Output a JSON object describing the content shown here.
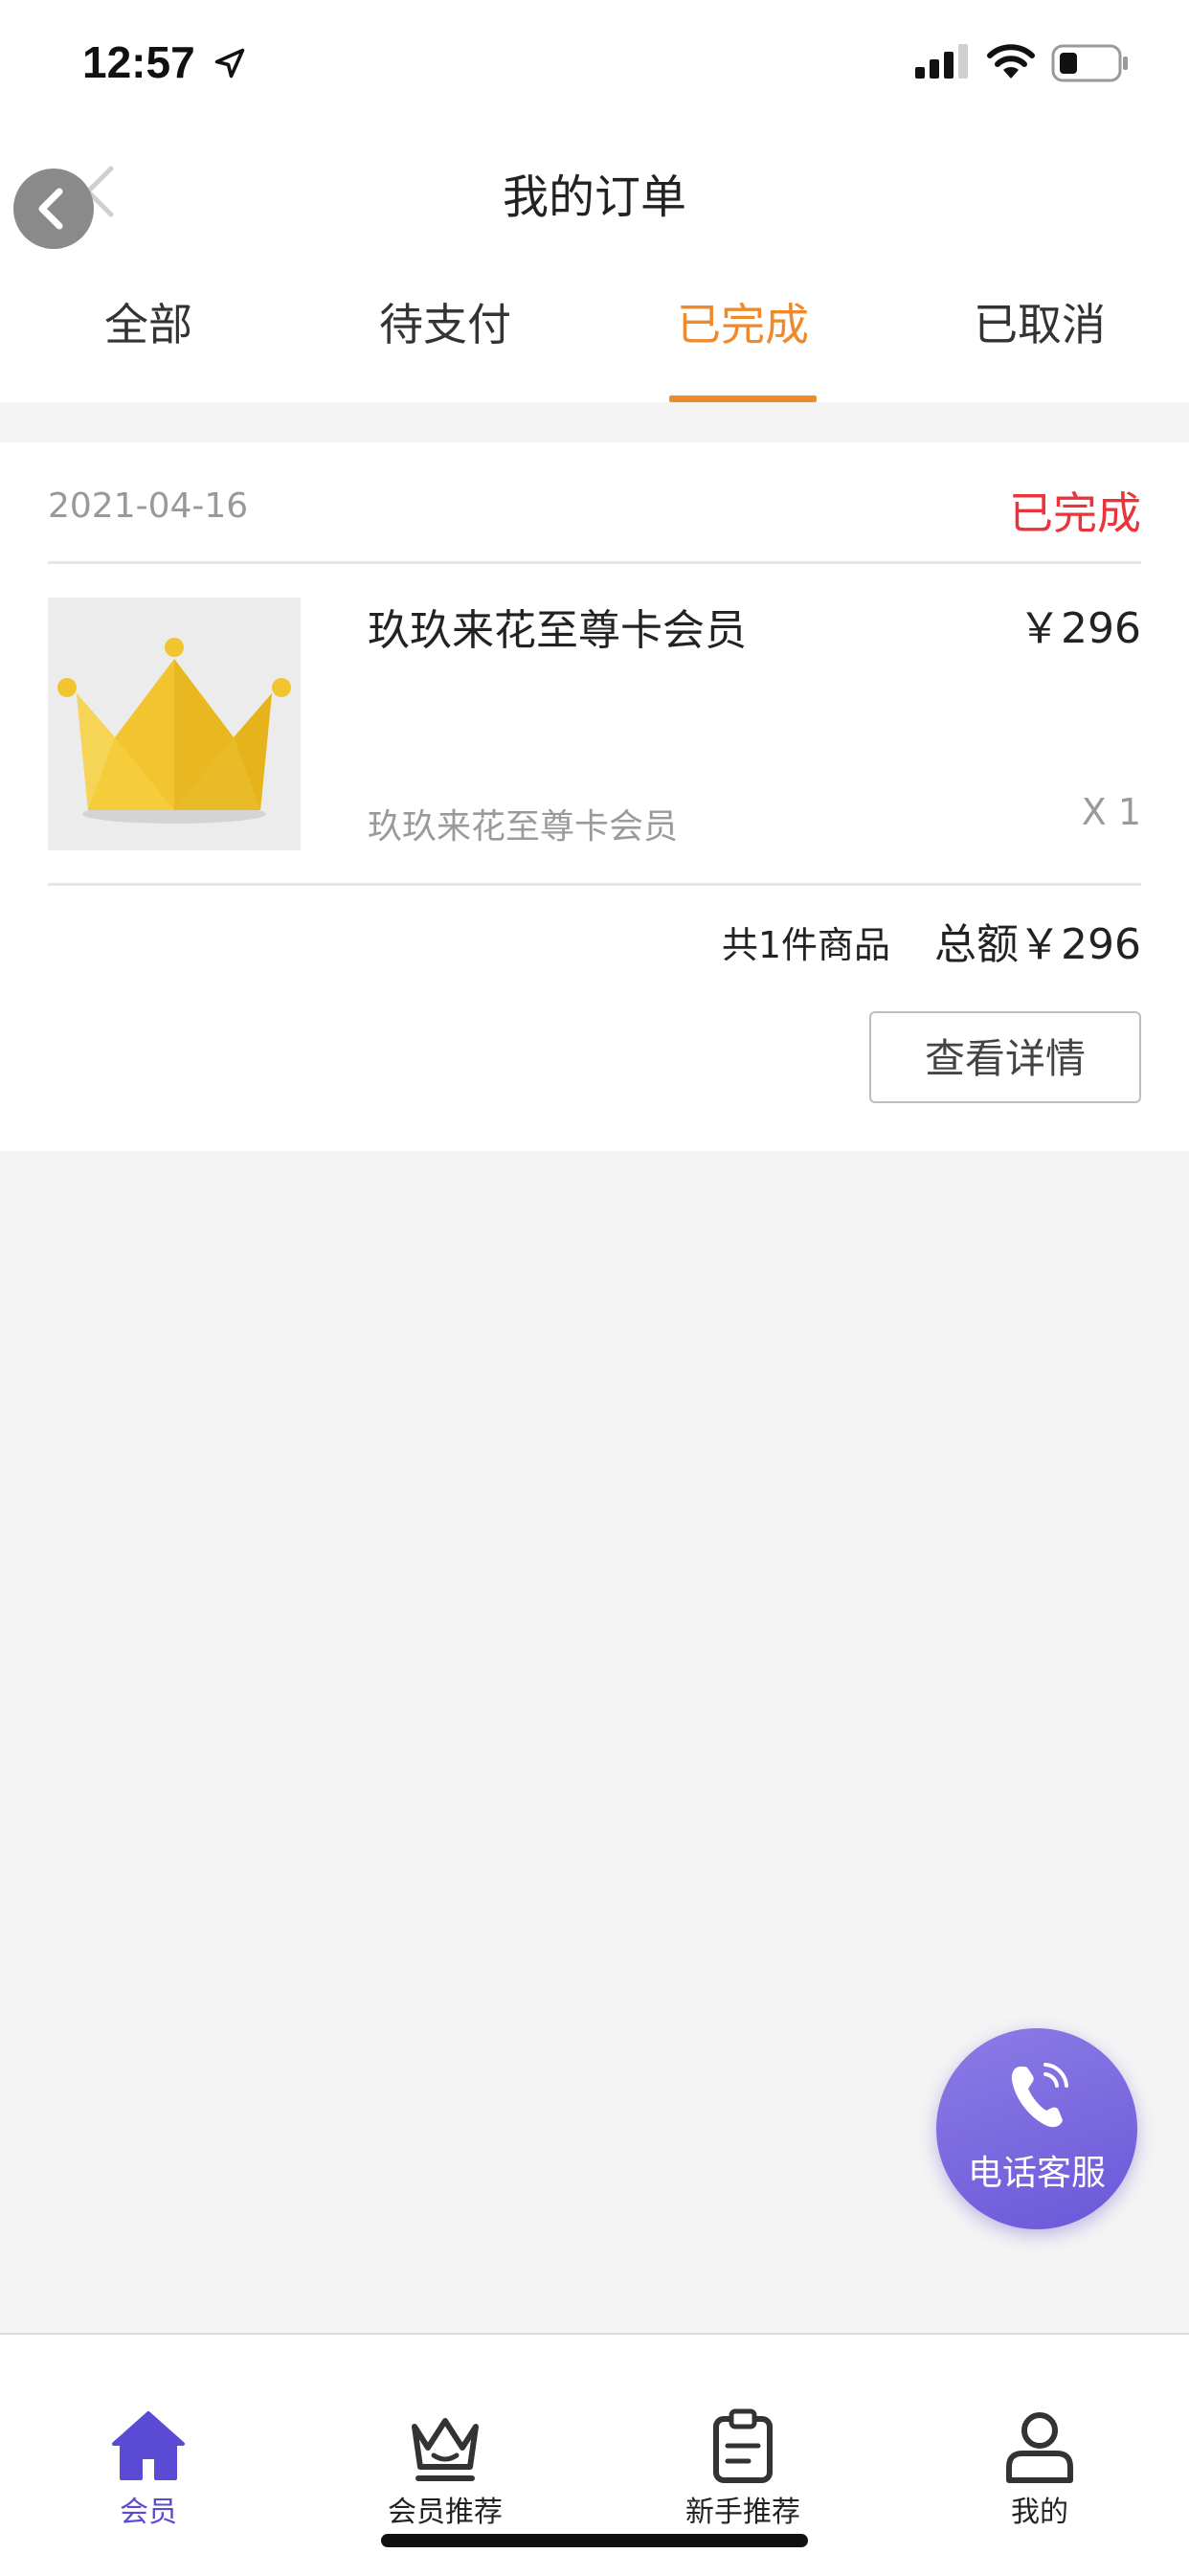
{
  "status_bar": {
    "time": "12:57"
  },
  "header": {
    "title": "我的订单"
  },
  "tabs": [
    {
      "label": "全部"
    },
    {
      "label": "待支付"
    },
    {
      "label": "已完成"
    },
    {
      "label": "已取消"
    }
  ],
  "active_tab": "已完成",
  "order": {
    "date": "2021-04-16",
    "status": "已完成",
    "product_name": "玖玖来花至尊卡会员",
    "product_price": "￥296",
    "product_subtitle": "玖玖来花至尊卡会员",
    "quantity": "X 1",
    "item_count": "共1件商品",
    "total": "总额￥296",
    "detail_button": "查看详情"
  },
  "fab": {
    "label": "电话客服",
    "icon": "phone-icon"
  },
  "tab_bar": {
    "items": [
      {
        "label": "会员",
        "icon": "home-icon"
      },
      {
        "label": "会员推荐",
        "icon": "crown-icon"
      },
      {
        "label": "新手推荐",
        "icon": "clipboard-icon"
      },
      {
        "label": "我的",
        "icon": "user-icon"
      }
    ],
    "active": "会员"
  },
  "colors": {
    "accent": "#ef8a2c",
    "status_red": "#e8343a",
    "purple": "#6a58d8",
    "background": "#f4f4f4"
  }
}
